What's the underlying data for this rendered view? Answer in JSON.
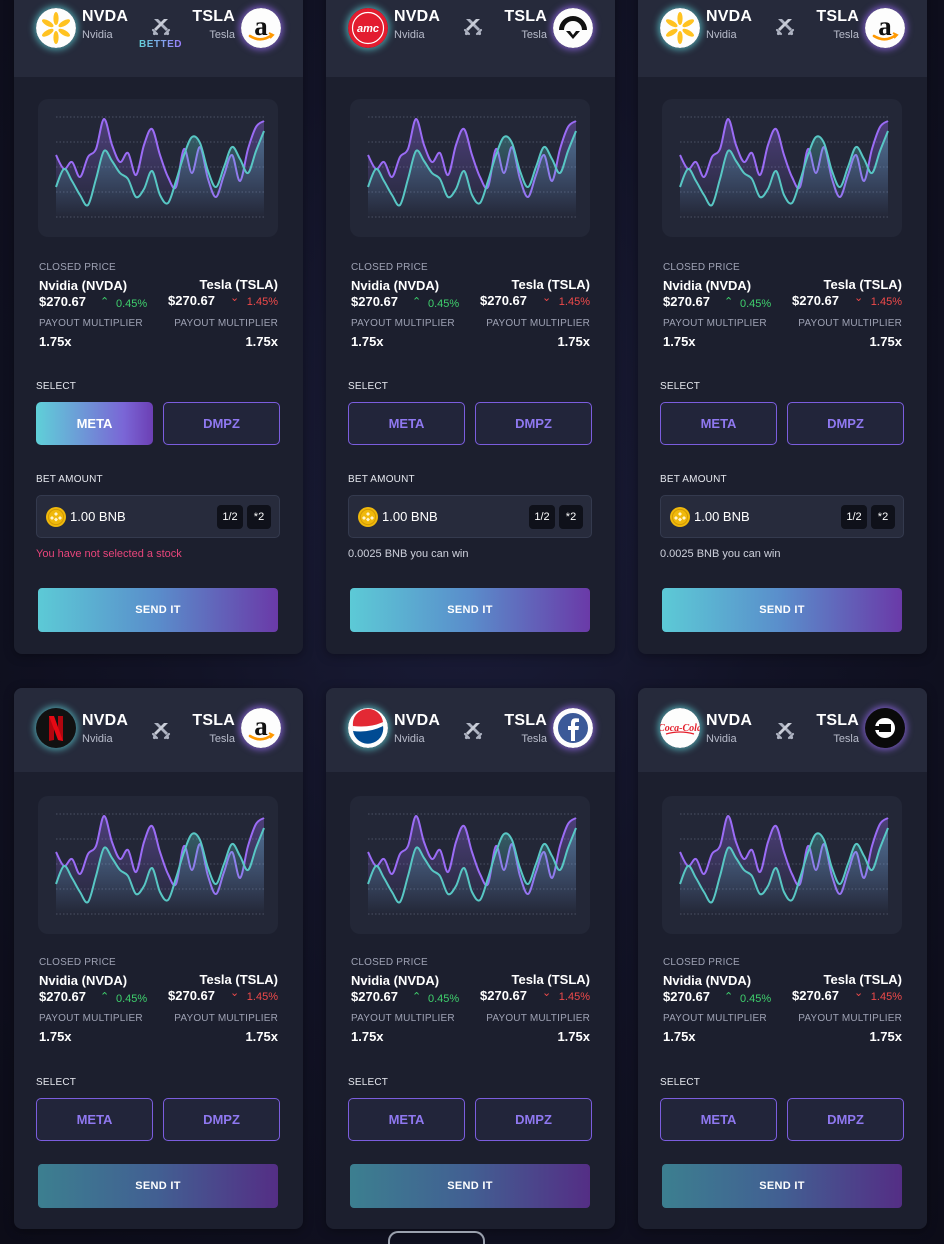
{
  "left_stock": {
    "ticker": "NVDA",
    "name": "Nvidia",
    "full_name": "Nvidia (NVDA)",
    "price": "$270.67",
    "change": "0.45%"
  },
  "right_stock": {
    "ticker": "TSLA",
    "name": "Tesla",
    "full_name": "Tesla (TSLA)",
    "price": "$270.67",
    "change": "1.45%"
  },
  "labels": {
    "closed_price": "CLOSED PRICE",
    "payout_multiplier": "PAYOUT MULTIPLIER",
    "multiplier_value": "1.75x",
    "select": "SELECT",
    "bet_amount": "BET AMOUNT",
    "send": "SEND IT",
    "half": "1/2",
    "double": "*2",
    "betted": "BETTED"
  },
  "options": [
    "META",
    "DMPZ"
  ],
  "bet": {
    "amount": "1.00 BNB",
    "error": "You have not selected a stock",
    "win_note": "0.0025 BNB you can win"
  },
  "icons": {
    "versus": "crossed-swords-icon",
    "coin": "bnb-coin-icon",
    "cards": [
      {
        "left": "walmart-spark-logo",
        "right": "amazon-logo"
      },
      {
        "left": "amc-logo",
        "right": "nio-logo"
      },
      {
        "left": "walmart-spark-logo",
        "right": "amazon-logo"
      },
      {
        "left": "netflix-logo",
        "right": "amazon-logo"
      },
      {
        "left": "pepsi-logo",
        "right": "facebook-logo"
      },
      {
        "left": "coca-cola-logo",
        "right": "uber-logo"
      }
    ]
  },
  "chart_data": {
    "type": "line",
    "title": "",
    "xlabel": "",
    "ylabel": "",
    "x": [
      0,
      1,
      2,
      3,
      4,
      5,
      6,
      7,
      8,
      9,
      10,
      11,
      12,
      13,
      14,
      15,
      16,
      17,
      18,
      19,
      20,
      21,
      22,
      23,
      24,
      25,
      26
    ],
    "ylim": [
      0,
      100
    ],
    "grid": true,
    "series": [
      {
        "color": "#9b6cf6",
        "values": [
          62,
          48,
          55,
          40,
          60,
          68,
          98,
          72,
          55,
          64,
          42,
          72,
          88,
          62,
          40,
          30,
          68,
          44,
          70,
          38,
          20,
          42,
          62,
          36,
          68,
          90,
          96
        ]
      },
      {
        "color": "#58c7c4",
        "values": [
          30,
          48,
          36,
          22,
          12,
          38,
          66,
          56,
          44,
          38,
          20,
          28,
          46,
          22,
          14,
          36,
          62,
          80,
          74,
          46,
          30,
          50,
          70,
          58,
          44,
          66,
          86
        ]
      }
    ],
    "colors": {
      "accent_teal": "#5fd0d8",
      "accent_purple": "#8f78f0",
      "up": "#3fd06d",
      "down": "#ef4a4a",
      "error": "#e8457b"
    }
  }
}
